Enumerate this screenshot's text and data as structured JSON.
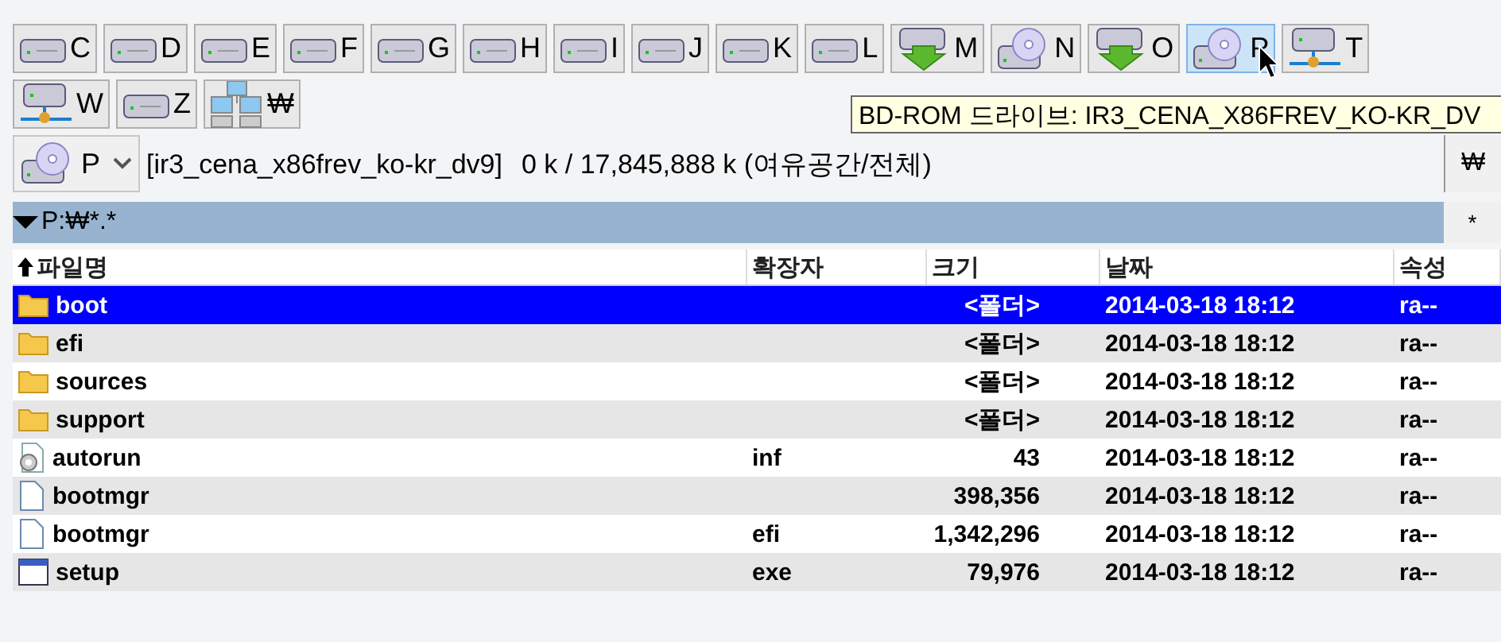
{
  "drive_bar": [
    {
      "letter": "C",
      "kind": "hdd",
      "selected": false
    },
    {
      "letter": "D",
      "kind": "hdd",
      "selected": false
    },
    {
      "letter": "E",
      "kind": "hdd",
      "selected": false
    },
    {
      "letter": "F",
      "kind": "hdd",
      "selected": false
    },
    {
      "letter": "G",
      "kind": "hdd",
      "selected": false
    },
    {
      "letter": "H",
      "kind": "hdd",
      "selected": false
    },
    {
      "letter": "I",
      "kind": "hdd",
      "selected": false
    },
    {
      "letter": "J",
      "kind": "hdd",
      "selected": false
    },
    {
      "letter": "K",
      "kind": "hdd",
      "selected": false
    },
    {
      "letter": "L",
      "kind": "hdd",
      "selected": false
    },
    {
      "letter": "M",
      "kind": "removable",
      "selected": false
    },
    {
      "letter": "N",
      "kind": "optical",
      "selected": false
    },
    {
      "letter": "O",
      "kind": "removable",
      "selected": false
    },
    {
      "letter": "P",
      "kind": "optical",
      "selected": true
    },
    {
      "letter": "T",
      "kind": "share",
      "selected": false
    },
    {
      "letter": "W",
      "kind": "share",
      "selected": false
    },
    {
      "letter": "Z",
      "kind": "hdd",
      "selected": false
    },
    {
      "letter": "₩",
      "kind": "network",
      "selected": false
    }
  ],
  "tooltip": "BD-ROM 드라이브: IR3_CENA_X86FREV_KO-KR_DV",
  "drive_selector": {
    "letter": "P",
    "volume": "[ir3_cena_x86frev_ko-kr_dv9]",
    "space": "0 k / 17,845,888 k (여유공간/전체)",
    "root_button": "₩"
  },
  "path": {
    "text": "P:₩*.*",
    "filter_button": "*"
  },
  "table": {
    "columns": [
      {
        "label": "파일명",
        "sorted": true
      },
      {
        "label": "확장자",
        "sorted": false
      },
      {
        "label": "크기",
        "sorted": false
      },
      {
        "label": "날짜",
        "sorted": false
      },
      {
        "label": "속성",
        "sorted": false
      }
    ],
    "rows": [
      {
        "kind": "folder",
        "name": "boot",
        "ext": "",
        "size": "<폴더>",
        "date": "2014-03-18 18:12",
        "attr": "ra--",
        "selected": true
      },
      {
        "kind": "folder",
        "name": "efi",
        "ext": "",
        "size": "<폴더>",
        "date": "2014-03-18 18:12",
        "attr": "ra--",
        "selected": false
      },
      {
        "kind": "folder",
        "name": "sources",
        "ext": "",
        "size": "<폴더>",
        "date": "2014-03-18 18:12",
        "attr": "ra--",
        "selected": false
      },
      {
        "kind": "folder",
        "name": "support",
        "ext": "",
        "size": "<폴더>",
        "date": "2014-03-18 18:12",
        "attr": "ra--",
        "selected": false
      },
      {
        "kind": "settings",
        "name": "autorun",
        "ext": "inf",
        "size": "43",
        "date": "2014-03-18 18:12",
        "attr": "ra--",
        "selected": false
      },
      {
        "kind": "file",
        "name": "bootmgr",
        "ext": "",
        "size": "398,356",
        "date": "2014-03-18 18:12",
        "attr": "ra--",
        "selected": false
      },
      {
        "kind": "file",
        "name": "bootmgr",
        "ext": "efi",
        "size": "1,342,296",
        "date": "2014-03-18 18:12",
        "attr": "ra--",
        "selected": false
      },
      {
        "kind": "app",
        "name": "setup",
        "ext": "exe",
        "size": "79,976",
        "date": "2014-03-18 18:12",
        "attr": "ra--",
        "selected": false
      }
    ]
  }
}
